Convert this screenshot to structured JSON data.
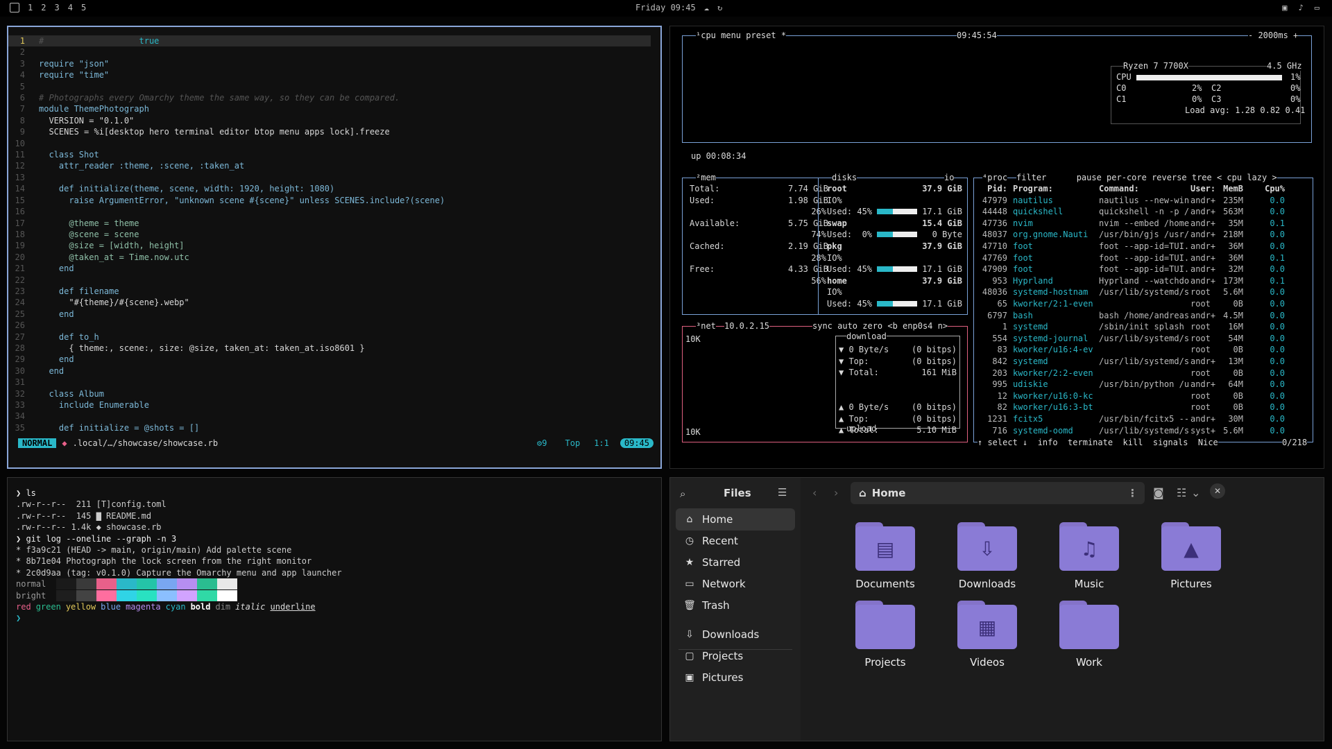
{
  "topbar": {
    "workspaces": [
      "1",
      "2",
      "3",
      "4",
      "5"
    ],
    "clock": "Friday 09:45"
  },
  "nvim": {
    "lines": [
      [
        "1",
        "#",
        "                   true"
      ],
      [
        "2",
        ""
      ],
      [
        "3",
        "require \"json\""
      ],
      [
        "4",
        "require \"time\""
      ],
      [
        "5",
        ""
      ],
      [
        "6",
        "# Photographs every Omarchy theme the same way, so they can be compared."
      ],
      [
        "7",
        "module ThemePhotograph"
      ],
      [
        "8",
        "  VERSION = \"0.1.0\""
      ],
      [
        "9",
        "  SCENES = %i[desktop hero terminal editor btop menu apps lock].freeze"
      ],
      [
        "10",
        ""
      ],
      [
        "11",
        "  class Shot"
      ],
      [
        "12",
        "    attr_reader :theme, :scene, :taken_at"
      ],
      [
        "13",
        ""
      ],
      [
        "14",
        "    def initialize(theme, scene, width: 1920, height: 1080)"
      ],
      [
        "15",
        "      raise ArgumentError, \"unknown scene #{scene}\" unless SCENES.include?(scene)"
      ],
      [
        "16",
        ""
      ],
      [
        "17",
        "      @theme = theme"
      ],
      [
        "18",
        "      @scene = scene"
      ],
      [
        "19",
        "      @size = [width, height]"
      ],
      [
        "20",
        "      @taken_at = Time.now.utc"
      ],
      [
        "21",
        "    end"
      ],
      [
        "22",
        ""
      ],
      [
        "23",
        "    def filename"
      ],
      [
        "24",
        "      \"#{theme}/#{scene}.webp\""
      ],
      [
        "25",
        "    end"
      ],
      [
        "26",
        ""
      ],
      [
        "27",
        "    def to_h"
      ],
      [
        "28",
        "      { theme:, scene:, size: @size, taken_at: taken_at.iso8601 }"
      ],
      [
        "29",
        "    end"
      ],
      [
        "30",
        "  end"
      ],
      [
        "31",
        ""
      ],
      [
        "32",
        "  class Album"
      ],
      [
        "33",
        "    include Enumerable"
      ],
      [
        "34",
        ""
      ],
      [
        "35",
        "    def initialize = @shots = []"
      ]
    ],
    "status": {
      "mode": "NORMAL",
      "path": ".local/…/showcase/showcase.rb",
      "lsp": "9",
      "pos": "Top",
      "cursor": "1:1",
      "time": "09:45"
    }
  },
  "btop": {
    "cpu": {
      "tabs": "¹cpu menu preset *",
      "clock": "09:45:54",
      "interval": "- 2000ms +",
      "model": "Ryzen 7 7700X",
      "freq": "4.5 GHz",
      "total": "1%",
      "cores": [
        [
          "C0",
          "2%"
        ],
        [
          "C1",
          "0%"
        ],
        [
          "C2",
          "0%"
        ],
        [
          "C3",
          "0%"
        ]
      ],
      "load": "Load avg: 1.28 0.82 0.41",
      "uptime": "up 00:08:34"
    },
    "mem": {
      "title": "²mem",
      "rows": [
        [
          "Total:",
          "7.74 GiB"
        ],
        [
          "Used:",
          "1.98 GiB"
        ],
        [
          "",
          "26%"
        ],
        [
          "Available:",
          "5.75 GiB"
        ],
        [
          "",
          "74%"
        ],
        [
          "Cached:",
          "2.19 GiB"
        ],
        [
          "",
          "28%"
        ],
        [
          "Free:",
          "4.33 GiB"
        ],
        [
          "",
          "56%"
        ]
      ]
    },
    "disks": {
      "title": "disks",
      "io": "io",
      "rows": [
        [
          "root",
          "37.9 GiB"
        ],
        [
          "IO%",
          ""
        ],
        [
          "Used: 45%",
          "17.1 GiB"
        ],
        [
          "swap",
          "15.4 GiB"
        ],
        [
          "Used:  0%",
          "0 Byte"
        ],
        [
          "pkg",
          "37.9 GiB"
        ],
        [
          "IO%",
          ""
        ],
        [
          "Used: 45%",
          "17.1 GiB"
        ],
        [
          "home",
          "37.9 GiB"
        ],
        [
          "IO%",
          ""
        ],
        [
          "Used: 45%",
          "17.1 GiB"
        ]
      ]
    },
    "net": {
      "title": "³net",
      "ip": "10.0.2.15",
      "opts": "sync auto zero <b enp0s4 n>",
      "scale_top": "10K",
      "scale_bot": "10K",
      "download": "download",
      "upload": "upload",
      "rows": [
        [
          "▼ 0 Byte/s",
          "(0 bitps)"
        ],
        [
          "▼ Top:",
          "(0 bitps)"
        ],
        [
          "▼ Total:",
          "161 MiB"
        ],
        [
          "▲ 0 Byte/s",
          "(0 bitps)"
        ],
        [
          "▲ Top:",
          "(0 bitps)"
        ],
        [
          "▲ Total:",
          "5.10 MiB"
        ]
      ]
    },
    "proc": {
      "title": "⁴proc",
      "opts": "filter      pause per-core reverse tree < cpu lazy >",
      "headers": [
        "Pid:",
        "Program:",
        "Command:",
        "User:",
        "MemB",
        "Cpu%"
      ],
      "rows": [
        [
          "47979",
          "nautilus",
          "nautilus --new-win",
          "andr+",
          "235M",
          "0.0"
        ],
        [
          "44448",
          "quickshell",
          "quickshell -n -p /",
          "andr+",
          "563M",
          "0.0"
        ],
        [
          "47736",
          "nvim",
          "nvim --embed /home",
          "andr+",
          "35M",
          "0.1"
        ],
        [
          "48037",
          "org.gnome.Nauti",
          "/usr/bin/gjs /usr/",
          "andr+",
          "218M",
          "0.0"
        ],
        [
          "47710",
          "foot",
          "foot --app-id=TUI.",
          "andr+",
          "36M",
          "0.0"
        ],
        [
          "47769",
          "foot",
          "foot --app-id=TUI.",
          "andr+",
          "36M",
          "0.1"
        ],
        [
          "47909",
          "foot",
          "foot --app-id=TUI.",
          "andr+",
          "32M",
          "0.0"
        ],
        [
          "953",
          "Hyprland",
          "Hyprland --watchdo",
          "andr+",
          "173M",
          "0.1"
        ],
        [
          "48036",
          "systemd-hostnam",
          "/usr/lib/systemd/s",
          "root",
          "5.6M",
          "0.0"
        ],
        [
          "65",
          "kworker/2:1-even",
          "",
          "root",
          "0B",
          "0.0"
        ],
        [
          "6797",
          "bash",
          "bash /home/andreas",
          "andr+",
          "4.5M",
          "0.0"
        ],
        [
          "1",
          "systemd",
          "/sbin/init splash",
          "root",
          "16M",
          "0.0"
        ],
        [
          "554",
          "systemd-journal",
          "/usr/lib/systemd/s",
          "root",
          "54M",
          "0.0"
        ],
        [
          "83",
          "kworker/u16:4-ev",
          "",
          "root",
          "0B",
          "0.0"
        ],
        [
          "842",
          "systemd",
          "/usr/lib/systemd/s",
          "andr+",
          "13M",
          "0.0"
        ],
        [
          "203",
          "kworker/2:2-even",
          "",
          "root",
          "0B",
          "0.0"
        ],
        [
          "995",
          "udiskie",
          "/usr/bin/python /u",
          "andr+",
          "64M",
          "0.0"
        ],
        [
          "12",
          "kworker/u16:0-kc",
          "",
          "root",
          "0B",
          "0.0"
        ],
        [
          "82",
          "kworker/u16:3-bt",
          "",
          "root",
          "0B",
          "0.0"
        ],
        [
          "1231",
          "fcitx5",
          "/usr/bin/fcitx5 --",
          "andr+",
          "30M",
          "0.0"
        ],
        [
          "716",
          "systemd-oomd",
          "/usr/lib/systemd/s",
          "syst+",
          "5.6M",
          "0.0"
        ]
      ],
      "footer": "↑ select ↓  info  terminate  kill  signals  Nice",
      "count": "0/218"
    }
  },
  "terminal": {
    "lines": [
      {
        "t": "❯ ls",
        "c": "#eee"
      },
      {
        "t": ".rw-r--r--  211 [T]config.toml",
        "c": "#ccc"
      },
      {
        "t": ".rw-r--r--  145 ▇ README.md",
        "c": "#ccc"
      },
      {
        "t": ".rw-r--r-- 1.4k ◆ showcase.rb",
        "c": "#ccc"
      },
      {
        "t": "❯ git log --oneline --graph -n 3",
        "c": "#eee"
      },
      {
        "t": "* f3a9c21 (HEAD -> main, origin/main) Add palette scene",
        "c": "#ccc"
      },
      {
        "t": "* 8b71e04 Photograph the lock screen from the right monitor",
        "c": "#ccc"
      },
      {
        "t": "* 2c0d9aa (tag: v0.1.0) Capture the Omarchy menu and app launcher",
        "c": "#ccc"
      }
    ],
    "normal": "normal",
    "bright": "bright",
    "palette": [
      "#1a1a1a",
      "#3a3a3a",
      "#e8608a",
      "#2ab8c8",
      "#24c4a8",
      "#79a6f0",
      "#b68ef0",
      "#2abd90",
      "#e8e8e8"
    ],
    "styles": [
      "red",
      "green",
      "yellow",
      "blue",
      "magenta",
      "cyan",
      "bold",
      "dim",
      "italic",
      "underline"
    ],
    "prompt": "❯"
  },
  "files": {
    "title": "Files",
    "location": "Home",
    "sidebar": [
      {
        "label": "Home",
        "icon": "home-icon",
        "sel": true
      },
      {
        "label": "Recent",
        "icon": "clock-icon"
      },
      {
        "label": "Starred",
        "icon": "star-icon"
      },
      {
        "label": "Network",
        "icon": "network-icon"
      },
      {
        "label": "Trash",
        "icon": "trash-icon"
      },
      {
        "label": "Downloads",
        "icon": "download-icon"
      },
      {
        "label": "Projects",
        "icon": "folder-icon"
      },
      {
        "label": "Pictures",
        "icon": "image-icon"
      }
    ],
    "folders": [
      {
        "label": "Documents",
        "glyph": "▤"
      },
      {
        "label": "Downloads",
        "glyph": "⇩"
      },
      {
        "label": "Music",
        "glyph": "♫"
      },
      {
        "label": "Pictures",
        "glyph": "▲"
      },
      {
        "label": "Projects",
        "glyph": ""
      },
      {
        "label": "Videos",
        "glyph": "▦"
      },
      {
        "label": "Work",
        "glyph": ""
      }
    ]
  }
}
